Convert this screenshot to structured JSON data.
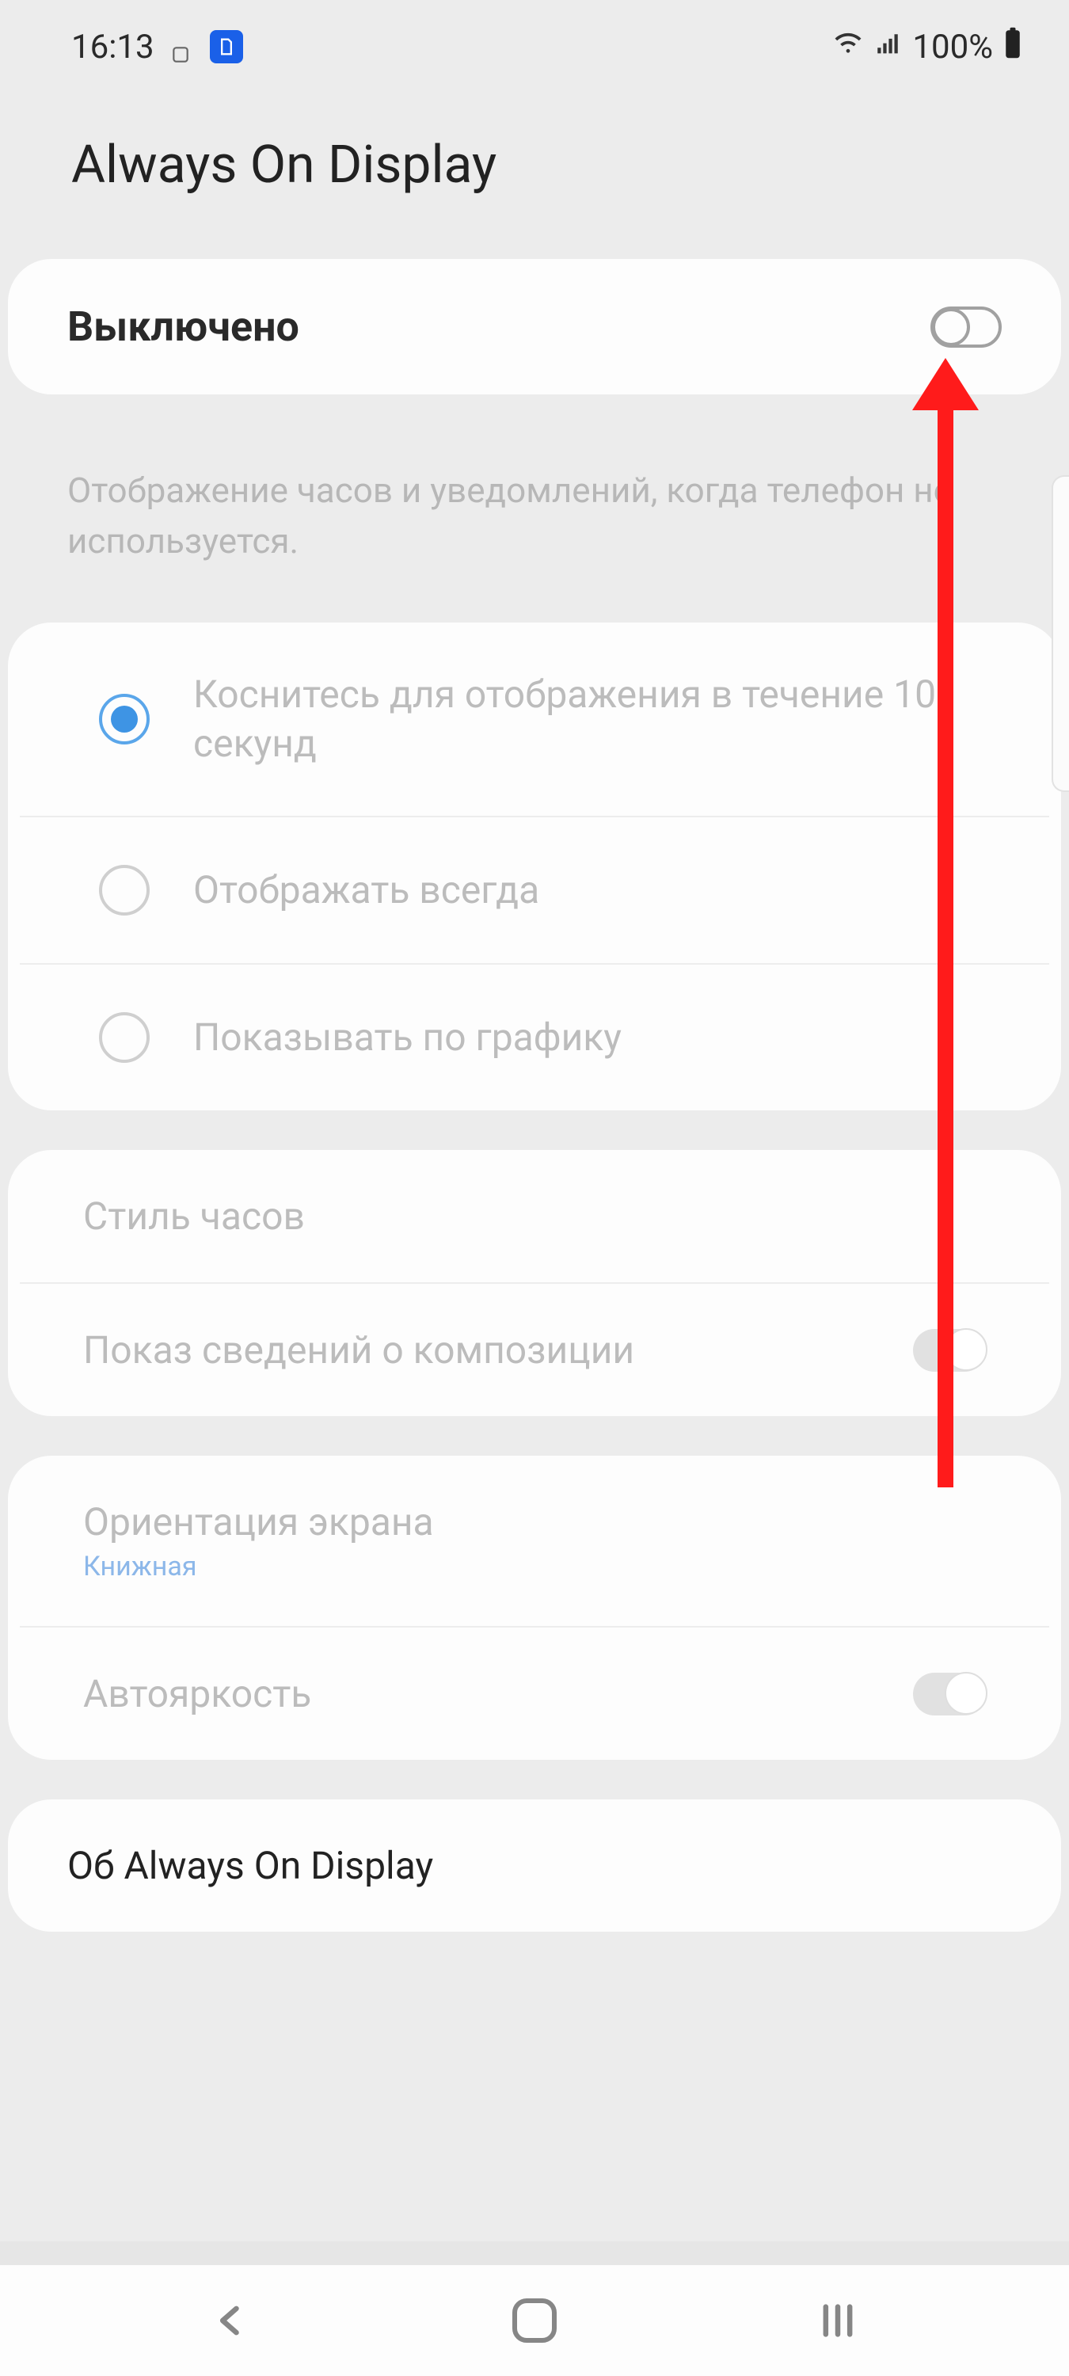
{
  "status": {
    "time": "16:13",
    "battery_text": "100%"
  },
  "header": {
    "title": "Always On Display"
  },
  "master": {
    "label": "Выключено"
  },
  "description": "Отображение часов и уведомлений, когда телефон не используется.",
  "radios": {
    "option0": "Коснитесь для отображения в течение 10 секунд",
    "option1": "Отображать всегда",
    "option2": "Показывать по графику"
  },
  "settings": {
    "clock_style": "Стиль часов",
    "music_info": "Показ сведений о композиции",
    "orientation": "Ориентация экрана",
    "orientation_value": "Книжная",
    "auto_brightness": "Автояркость"
  },
  "about": {
    "label": "Об Always On Display"
  }
}
